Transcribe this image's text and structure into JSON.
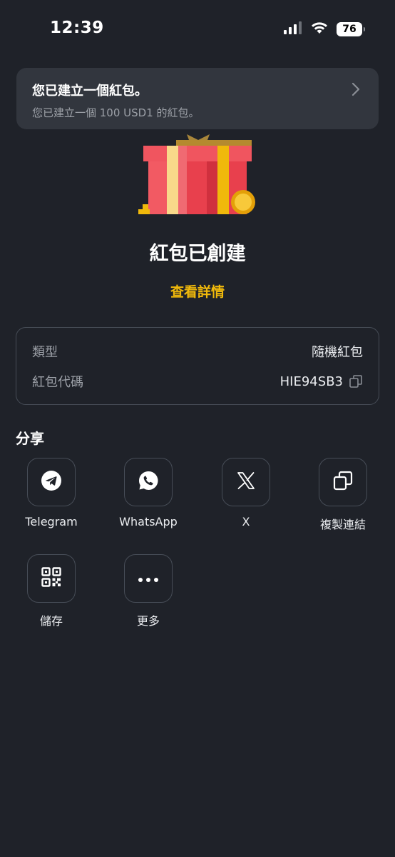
{
  "status_bar": {
    "time": "12:39",
    "battery": "76"
  },
  "notification": {
    "title": "您已建立一個紅包。",
    "subtitle": "您已建立一個 100 USD1 的紅包。"
  },
  "main": {
    "title": "紅包已創建",
    "details_link": "查看詳情"
  },
  "info": {
    "type_label": "類型",
    "type_value": "隨機紅包",
    "code_label": "紅包代碼",
    "code_value": "HIE94SB3"
  },
  "share": {
    "title": "分享",
    "items": [
      {
        "label": "Telegram",
        "icon": "telegram-icon"
      },
      {
        "label": "WhatsApp",
        "icon": "whatsapp-icon"
      },
      {
        "label": "X",
        "icon": "x-logo-icon"
      },
      {
        "label": "複製連結",
        "icon": "copy-link-icon"
      },
      {
        "label": "儲存",
        "icon": "qr-code-icon"
      },
      {
        "label": "更多",
        "icon": "more-icon"
      }
    ]
  },
  "colors": {
    "background": "#1f2229",
    "accent": "#f0b90b",
    "card_border": "#474d57",
    "banner": "#32363e"
  }
}
